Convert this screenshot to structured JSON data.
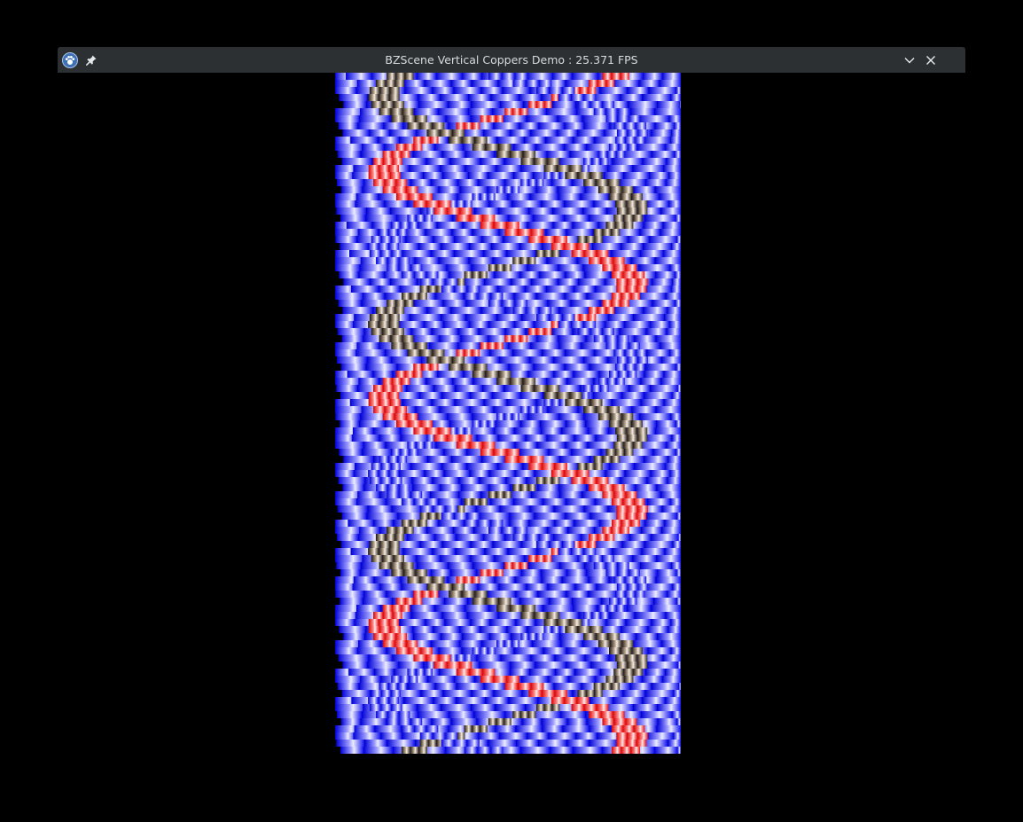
{
  "window": {
    "title": "BZScene Vertical Coppers Demo : 25.371 FPS"
  },
  "icons": {
    "app": "paw-icon",
    "pin": "pin-icon",
    "minimize": "chevron-down-icon",
    "close": "close-icon"
  },
  "colors": {
    "titlebar_bg": "#2d3033",
    "title_text": "#d8dadc",
    "background": "#000000",
    "copper_blue": "#2a2aff",
    "copper_red": "#ff2a2a",
    "copper_beige": "#6b5a48"
  }
}
